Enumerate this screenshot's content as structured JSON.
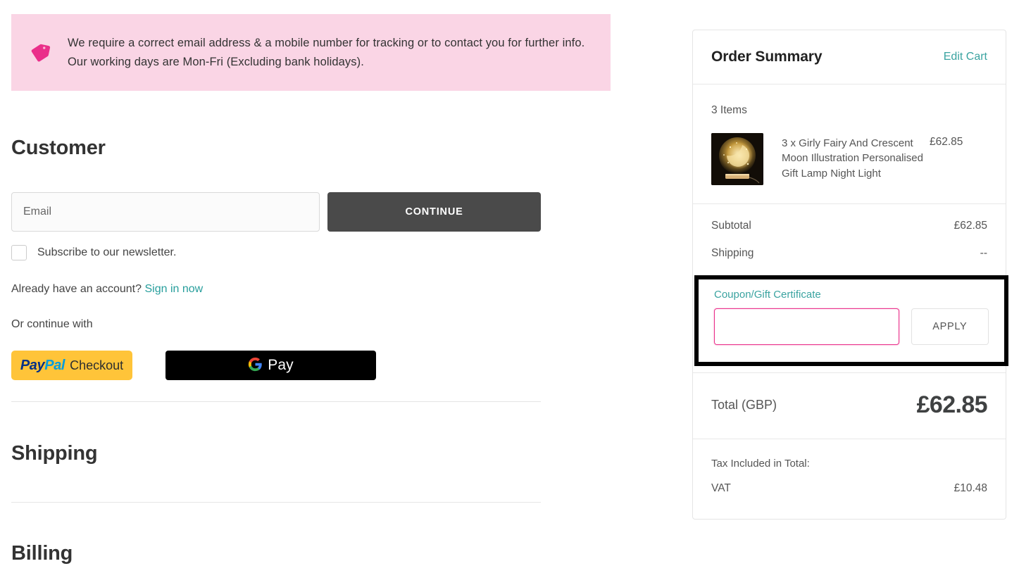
{
  "notice": {
    "icon": "price-tag-icon",
    "text": "We require a correct email address & a mobile number for tracking or to contact you for further info. Our working days are Mon-Fri (Excluding bank holidays).",
    "bg_color": "#fad5e5",
    "icon_color": "#ea2f8a"
  },
  "customer": {
    "heading": "Customer",
    "email_placeholder": "Email",
    "email_value": "",
    "continue_label": "CONTINUE",
    "newsletter_label": "Subscribe to our newsletter.",
    "newsletter_checked": false,
    "account_prompt": "Already have an account?",
    "sign_in_label": "Sign in now",
    "or_continue_with": "Or continue with",
    "paypal": {
      "pay": "Pay",
      "pal": "Pal",
      "checkout": "Checkout",
      "bg_color": "#ffc439"
    },
    "googlepay": {
      "label": "Pay",
      "bg_color": "#000000"
    }
  },
  "shipping": {
    "heading": "Shipping"
  },
  "billing": {
    "heading": "Billing"
  },
  "order_summary": {
    "title": "Order Summary",
    "edit_cart_label": "Edit Cart",
    "items_count_label": "3 Items",
    "items": [
      {
        "name": "3 x Girly Fairy And Crescent Moon Illustration Personalised Gift Lamp Night Light",
        "price": "£62.85",
        "thumbnail": "fairy-moon-night-lamp-photo"
      }
    ],
    "lines": [
      {
        "label": "Subtotal",
        "value": "£62.85"
      },
      {
        "label": "Shipping",
        "value": "--"
      }
    ],
    "coupon": {
      "label": "Coupon/Gift Certificate",
      "input_value": "",
      "apply_label": "APPLY",
      "focus_border_color": "#ea2f8a",
      "highlight_color": "#000000"
    },
    "total": {
      "label": "Total (GBP)",
      "value": "£62.85"
    },
    "tax": {
      "heading": "Tax Included in Total:",
      "rows": [
        {
          "label": "VAT",
          "value": "£10.48"
        }
      ]
    },
    "accent_color": "#3aa3a0"
  }
}
